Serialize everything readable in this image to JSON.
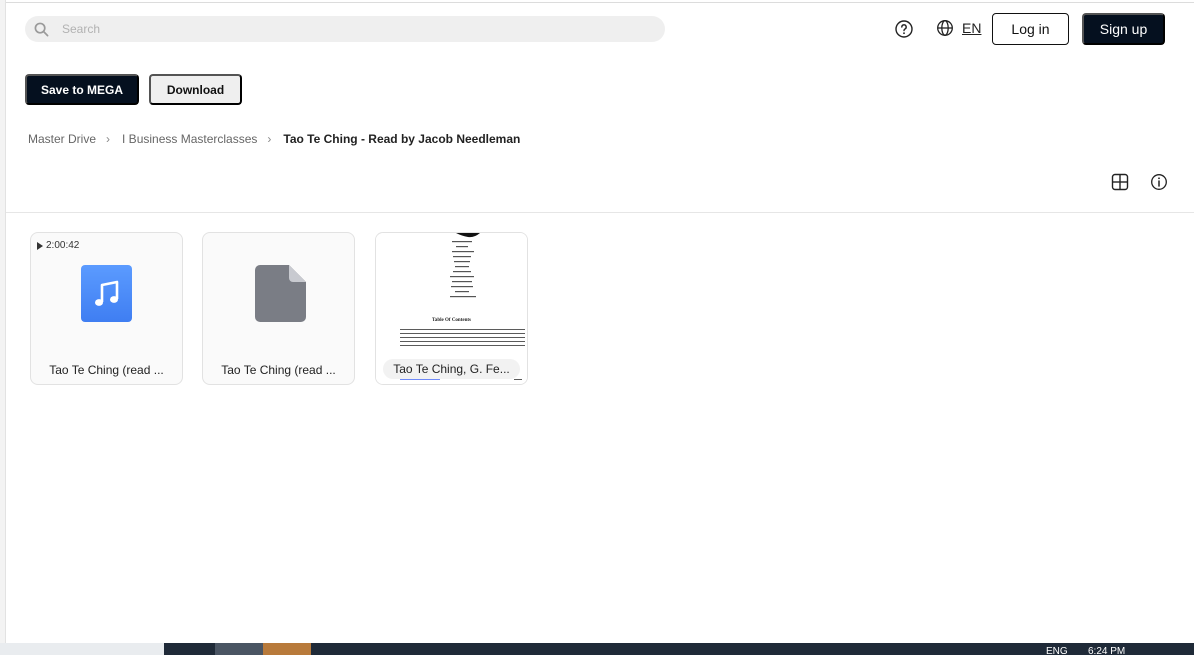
{
  "search": {
    "placeholder": "Search",
    "value": ""
  },
  "header": {
    "help_icon": "help-circle-icon",
    "language_icon": "globe-icon",
    "language": "EN",
    "login_label": "Log in",
    "signup_label": "Sign up"
  },
  "actions": {
    "save_label": "Save to MEGA",
    "download_label": "Download"
  },
  "breadcrumb": {
    "items": [
      "Master Drive",
      "I Business Masterclasses"
    ],
    "current": "Tao Te Ching - Read by Jacob Needleman"
  },
  "view_controls": {
    "grid_icon": "grid-view-icon",
    "info_icon": "info-icon"
  },
  "files": [
    {
      "name": "Tao Te Ching (read ...",
      "type": "audio",
      "duration": "2:00:42",
      "icon": "music-note-icon"
    },
    {
      "name": "Tao Te Ching (read ...",
      "type": "generic",
      "icon": "file-icon"
    },
    {
      "name": "Tao Te Ching, G. Fe...",
      "type": "pdf",
      "thumbnail_heading": "Table Of Contents"
    }
  ],
  "taskbar": {
    "lang": "ENG",
    "time": "6:24 PM"
  },
  "colors": {
    "primary_button": "#05101f",
    "audio_icon": "#4a8af7",
    "file_icon": "#7a7d85"
  }
}
